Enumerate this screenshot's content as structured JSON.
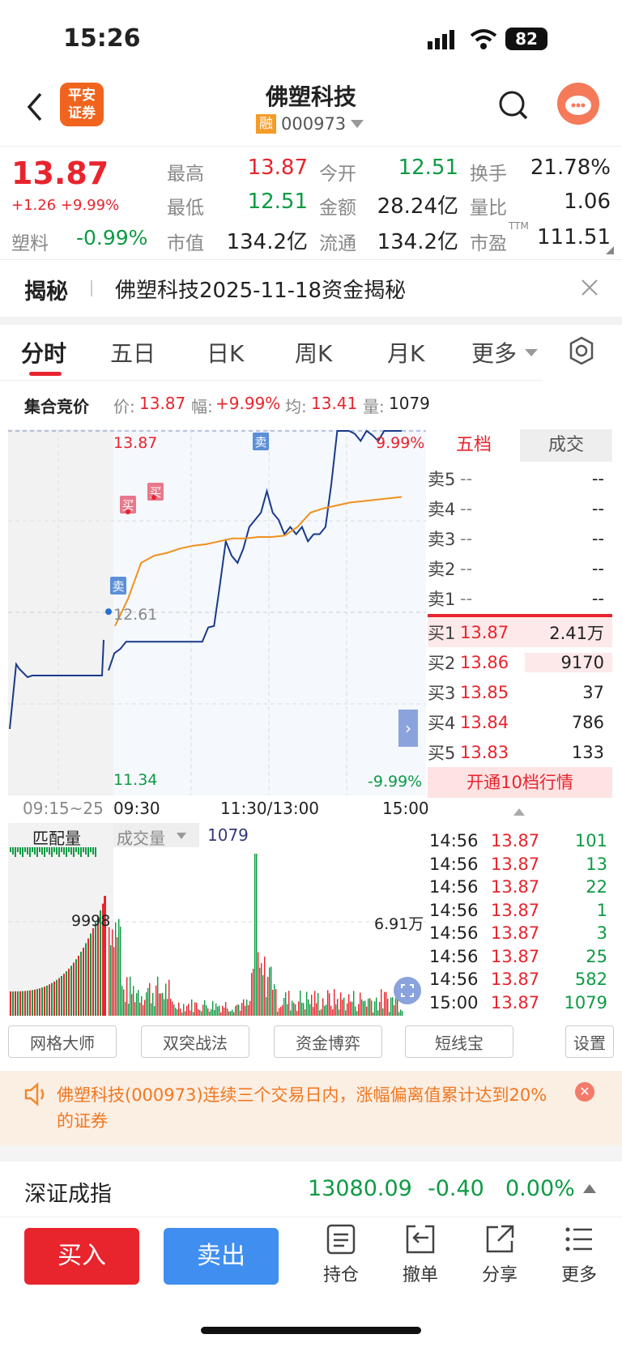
{
  "status": {
    "time": "15:26",
    "battery": "82"
  },
  "header": {
    "broker_logo": "平安\n证券",
    "broker_logo_line1": "平安",
    "broker_logo_line2": "证券",
    "stock_name": "佛塑科技",
    "margin_badge": "融",
    "stock_code": "000973"
  },
  "quote": {
    "price": "13.87",
    "change": "+1.26",
    "change_pct": "+9.99%",
    "sector_name": "塑料",
    "sector_change": "-0.99%",
    "fields": [
      {
        "label": "最高",
        "value": "13.87",
        "color": "red"
      },
      {
        "label": "今开",
        "value": "12.51",
        "color": "green"
      },
      {
        "label": "换手",
        "value": "21.78%",
        "color": "dark"
      },
      {
        "label": "最低",
        "value": "12.51",
        "color": "green"
      },
      {
        "label": "金额",
        "value": "28.24亿",
        "color": "dark"
      },
      {
        "label": "量比",
        "value": "1.06",
        "color": "dark"
      },
      {
        "label": "市值",
        "value": "134.2亿",
        "color": "dark"
      },
      {
        "label": "流通",
        "value": "134.2亿",
        "color": "dark"
      },
      {
        "label": "市盈",
        "value": "111.51",
        "color": "dark"
      }
    ],
    "pe_sup": "TTM"
  },
  "news": {
    "tag": "揭秘",
    "text": "佛塑科技2025-11-18资金揭秘"
  },
  "tabs": [
    "分时",
    "五日",
    "日K",
    "周K",
    "月K",
    "更多"
  ],
  "info_bar": {
    "label": "集合竞价",
    "price_label": "价:",
    "price": "13.87",
    "range_label": "幅:",
    "range": "+9.99%",
    "avg_label": "均:",
    "avg": "13.41",
    "vol_label": "量:",
    "vol": "1079"
  },
  "chart_data": {
    "type": "line",
    "series": [],
    "ylim": [
      11.34,
      13.87
    ],
    "labels": {
      "top_price": "13.87",
      "top_pct": "9.99%",
      "mid_price": "12.61",
      "bottom_price": "11.34",
      "bottom_pct": "-9.99%"
    },
    "x_ticks": [
      "09:15~25",
      "09:30",
      "11:30/13:00",
      "15:00"
    ],
    "markers": [
      "卖",
      "买",
      "买",
      "卖"
    ],
    "price_line": [
      12.2,
      12.32,
      12.35,
      12.4,
      12.4,
      12.4,
      12.4,
      12.4,
      12.4,
      12.4,
      12.4,
      12.4,
      12.4,
      12.4,
      12.4,
      12.4,
      12.4,
      12.5,
      12.51,
      12.8,
      13.1,
      13.0,
      12.95,
      13.05,
      13.2,
      13.25,
      13.3,
      13.45,
      13.3,
      13.25,
      13.15,
      13.2,
      13.15,
      13.2,
      13.1,
      13.15,
      13.15,
      13.2,
      13.5,
      13.87,
      13.87,
      13.87,
      13.85,
      13.8,
      13.87,
      13.84,
      13.8,
      13.87,
      13.87,
      13.87,
      13.87
    ],
    "avg_line": [
      12.51,
      12.7,
      12.95,
      13.0,
      13.02,
      13.05,
      13.07,
      13.08,
      13.1,
      13.12,
      13.12,
      13.13,
      13.13,
      13.14,
      13.2,
      13.3,
      13.33,
      13.35,
      13.37,
      13.38,
      13.39,
      13.4,
      13.41
    ],
    "volume_label": "成交量",
    "volume_value": "1079",
    "auction_label": "匹配量",
    "auction_value": "9998",
    "vol_max_label": "6.91万"
  },
  "order_book": {
    "tabs": [
      "五档",
      "成交"
    ],
    "asks": [
      {
        "label": "卖5",
        "price": "--",
        "vol": "--"
      },
      {
        "label": "卖4",
        "price": "--",
        "vol": "--"
      },
      {
        "label": "卖3",
        "price": "--",
        "vol": "--"
      },
      {
        "label": "卖2",
        "price": "--",
        "vol": "--"
      },
      {
        "label": "卖1",
        "price": "--",
        "vol": "--"
      }
    ],
    "bids": [
      {
        "label": "买1",
        "price": "13.87",
        "vol": "2.41万"
      },
      {
        "label": "买2",
        "price": "13.86",
        "vol": "9170"
      },
      {
        "label": "买3",
        "price": "13.85",
        "vol": "37"
      },
      {
        "label": "买4",
        "price": "13.84",
        "vol": "786"
      },
      {
        "label": "买5",
        "price": "13.83",
        "vol": "133"
      }
    ],
    "upgrade_btn": "开通10档行情"
  },
  "trades": [
    {
      "time": "14:56",
      "price": "13.87",
      "vol": "101"
    },
    {
      "time": "14:56",
      "price": "13.87",
      "vol": "13"
    },
    {
      "time": "14:56",
      "price": "13.87",
      "vol": "22"
    },
    {
      "time": "14:56",
      "price": "13.87",
      "vol": "1"
    },
    {
      "time": "14:56",
      "price": "13.87",
      "vol": "3"
    },
    {
      "time": "14:56",
      "price": "13.87",
      "vol": "25"
    },
    {
      "time": "14:56",
      "price": "13.87",
      "vol": "582"
    },
    {
      "time": "15:00",
      "price": "13.87",
      "vol": "1079"
    }
  ],
  "tools": [
    "网格大师",
    "双突战法",
    "资金博弈",
    "短线宝",
    "设置"
  ],
  "alert": {
    "text": "佛塑科技(000973)连续三个交易日内，涨幅偏离值累计达到20%的证券"
  },
  "index": {
    "name": "深证成指",
    "value": "13080.09",
    "change": "-0.40",
    "pct": "0.00%"
  },
  "bottom": {
    "buy": "买入",
    "sell": "卖出",
    "icons": [
      "持仓",
      "撤单",
      "分享",
      "更多"
    ]
  },
  "colors": {
    "up": "#e8242d",
    "down": "#0d9b43",
    "price_line": "#1a3a8a",
    "avg_line": "#f0901e",
    "buy_btn": "#e8242d",
    "sell_btn": "#3f8ef0"
  }
}
